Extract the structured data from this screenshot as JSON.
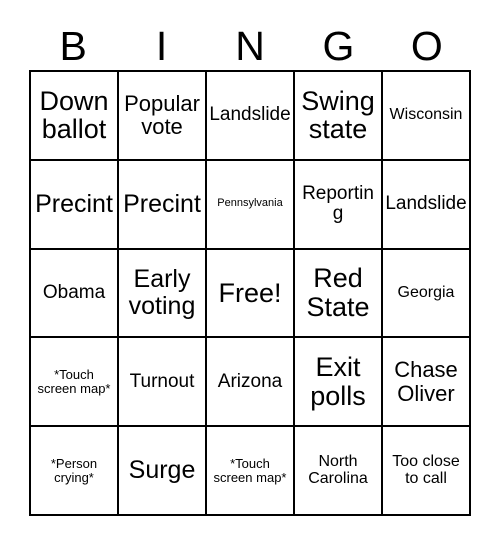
{
  "card": {
    "header_letters": [
      "B",
      "I",
      "N",
      "G",
      "O"
    ],
    "columns": 5,
    "rows": 5,
    "border_color": "#000000",
    "cell_background": "#ffffff",
    "text_color": "#000000",
    "cells": [
      {
        "text": "Down ballot",
        "size": "xl"
      },
      {
        "text": "Popular vote",
        "size": "md"
      },
      {
        "text": "Landslide",
        "size": "sm"
      },
      {
        "text": "Swing state",
        "size": "xl"
      },
      {
        "text": "Wisconsin",
        "size": "xs"
      },
      {
        "text": "Precint",
        "size": "lg"
      },
      {
        "text": "Precint",
        "size": "lg"
      },
      {
        "text": "Pennsylvania",
        "size": "tiny"
      },
      {
        "text": "Reporting",
        "size": "sm"
      },
      {
        "text": "Landslide",
        "size": "sm"
      },
      {
        "text": "Obama",
        "size": "sm"
      },
      {
        "text": "Early voting",
        "size": "lg"
      },
      {
        "text": "Free!",
        "size": "xl"
      },
      {
        "text": "Red State",
        "size": "xl"
      },
      {
        "text": "Georgia",
        "size": "xs"
      },
      {
        "text": "*Touch screen map*",
        "size": "xxs"
      },
      {
        "text": "Turnout",
        "size": "sm"
      },
      {
        "text": "Arizona",
        "size": "sm"
      },
      {
        "text": "Exit polls",
        "size": "xl"
      },
      {
        "text": "Chase Oliver",
        "size": "md"
      },
      {
        "text": "*Person crying*",
        "size": "xxs"
      },
      {
        "text": "Surge",
        "size": "lg"
      },
      {
        "text": "*Touch screen map*",
        "size": "xxs"
      },
      {
        "text": "North Carolina",
        "size": "xs"
      },
      {
        "text": "Too close to call",
        "size": "xs"
      }
    ]
  }
}
